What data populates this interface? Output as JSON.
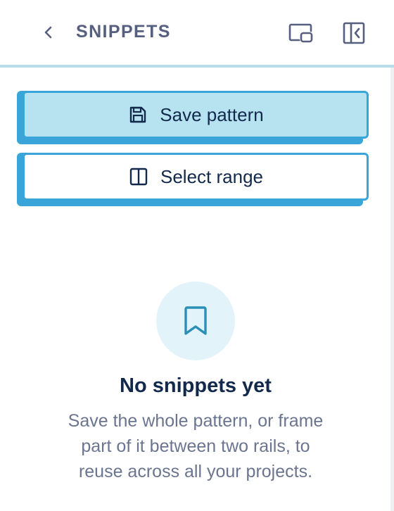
{
  "header": {
    "title": "SNIPPETS",
    "back_icon": "chevron-left-icon",
    "pip_icon": "picture-in-picture-icon",
    "collapse_icon": "collapse-panel-icon"
  },
  "actions": {
    "save_pattern": {
      "label": "Save pattern",
      "icon": "floppy-disk-icon"
    },
    "select_range": {
      "label": "Select range",
      "icon": "split-columns-icon"
    }
  },
  "empty_state": {
    "icon": "bookmark-icon",
    "title": "No snippets yet",
    "description_lines": [
      "Save the whole pattern, or frame",
      "part of it between two rails, to",
      "reuse across all your projects."
    ]
  },
  "colors": {
    "accent": "#3aa5d8",
    "accent_light": "#b7e3f1",
    "header_border": "#b8dde9",
    "title_text": "#13294b",
    "muted_text": "#6b7590",
    "header_text": "#56607e"
  }
}
